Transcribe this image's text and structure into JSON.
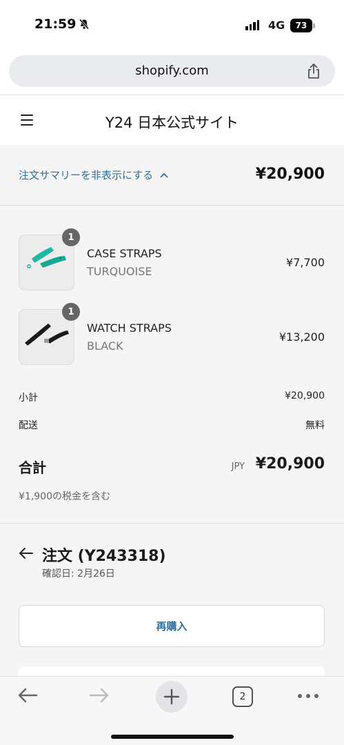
{
  "status_bar": {
    "time": "21:59",
    "network": "4G",
    "battery": "73"
  },
  "browser": {
    "url": "shopify.com",
    "tab_count": "2"
  },
  "store": {
    "title": "Y24 日本公式サイト"
  },
  "summary": {
    "toggle_label": "注文サマリーを非表示にする",
    "total": "¥20,900",
    "items": [
      {
        "quantity": "1",
        "name": "CASE STRAPS",
        "variant": "TURQUOISE",
        "price": "¥7,700",
        "color": "#1fb8a4"
      },
      {
        "quantity": "1",
        "name": "WATCH STRAPS",
        "variant": "BLACK",
        "price": "¥13,200",
        "color": "#1a1a1a"
      }
    ],
    "subtotal_label": "小計",
    "subtotal_value": "¥20,900",
    "shipping_label": "配送",
    "shipping_value": "無料",
    "total_label": "合計",
    "currency": "JPY",
    "total_value": "¥20,900",
    "tax_note": "¥1,900の税金を含む"
  },
  "order": {
    "title": "注文 (Y243318)",
    "date": "確認日: 2月26日",
    "rebuy_label": "再購入"
  },
  "colors": {
    "link": "#2d6e9e",
    "summary_bg": "#f5f5f5"
  }
}
